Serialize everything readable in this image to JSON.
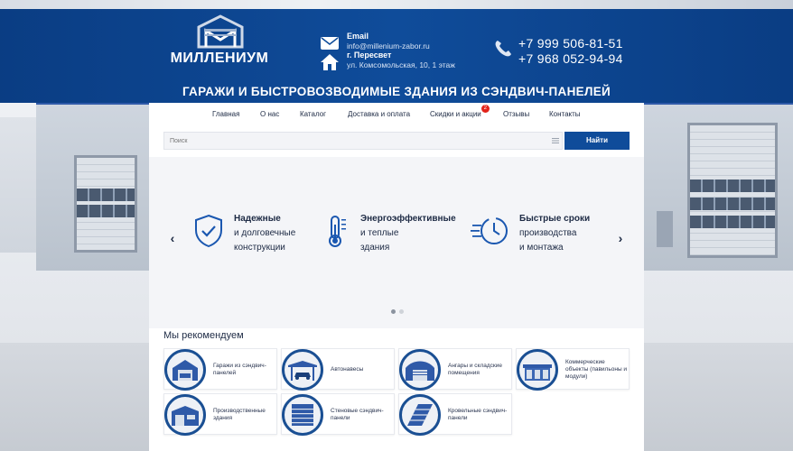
{
  "header": {
    "logo_text": "МИЛЛЕНИУМ",
    "email_label": "Email",
    "email_value": "info@millenium-zabor.ru",
    "city": "г. Пересвет",
    "address": "ул. Комсомольская, 10, 1 этаж",
    "phone_1": "+7 999 506-81-51",
    "phone_2": "+7 968 052-94-94",
    "slogan": "ГАРАЖИ И БЫСТРОВОЗВОДИМЫЕ ЗДАНИЯ ИЗ СЭНДВИЧ-ПАНЕЛЕЙ"
  },
  "nav": {
    "items": [
      {
        "label": "Главная"
      },
      {
        "label": "О нас"
      },
      {
        "label": "Каталог"
      },
      {
        "label": "Доставка и оплата"
      },
      {
        "label": "Скидки и акции",
        "badge": "2"
      },
      {
        "label": "Отзывы"
      },
      {
        "label": "Контакты"
      }
    ]
  },
  "search": {
    "placeholder": "Поиск",
    "button_label": "Найти"
  },
  "slider": {
    "prev_label": "‹",
    "next_label": "›",
    "features": [
      {
        "icon": "shield-check-icon",
        "line1": "Надежные",
        "line2": "и долговечные",
        "line3": "конструкции"
      },
      {
        "icon": "thermometer-icon",
        "line1": "Энергоэффективные",
        "line2": "и теплые",
        "line3": "здания"
      },
      {
        "icon": "fast-clock-icon",
        "line1": "Быстрые сроки",
        "line2": "производства",
        "line3": "и монтажа"
      }
    ],
    "active_dot": 0,
    "dot_count": 2
  },
  "recommend": {
    "title": "Мы рекомендуем",
    "cards": [
      {
        "label": "Гаражи из сэндвич-панелей",
        "icon": "garage-icon"
      },
      {
        "label": "Автонавесы",
        "icon": "carport-icon"
      },
      {
        "label": "Ангары и складские помещения",
        "icon": "hangar-icon"
      },
      {
        "label": "Коммерческие объекты (павильоны и модули)",
        "icon": "pavilion-icon"
      },
      {
        "label": "Производственные здания",
        "icon": "factory-icon"
      },
      {
        "label": "Стеновые сэндвич-панели",
        "icon": "wall-panel-icon"
      },
      {
        "label": "Кровельные сэндвич-панели",
        "icon": "roof-panel-icon"
      }
    ]
  },
  "colors": {
    "brand_blue": "#0f4c9a",
    "accent_red": "#e2231a",
    "text_dark": "#1d2a44"
  }
}
